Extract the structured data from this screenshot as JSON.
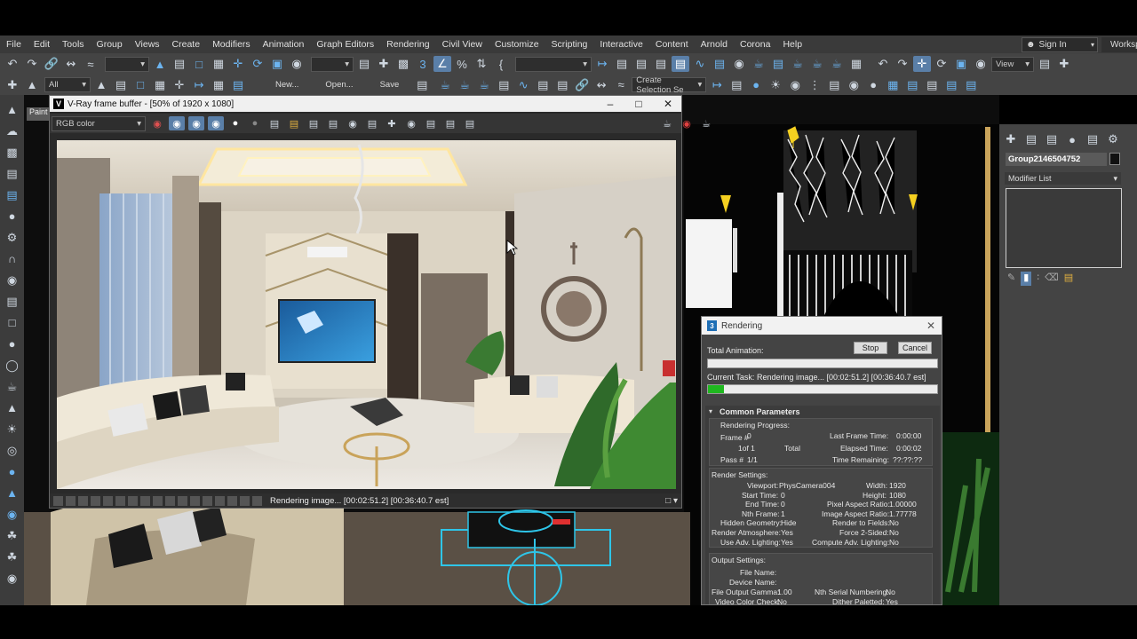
{
  "menu": [
    "File",
    "Edit",
    "Tools",
    "Group",
    "Views",
    "Create",
    "Modifiers",
    "Animation",
    "Graph Editors",
    "Rendering",
    "Civil View",
    "Customize",
    "Scripting",
    "Interactive",
    "Content",
    "Arnold",
    "Corona",
    "Help"
  ],
  "signin_label": "Sign In",
  "workspace_label": "Workspa",
  "toolbar": {
    "filter_value": "All",
    "new_label": "New...",
    "open_label": "Open...",
    "save_label": "Save",
    "view_label": "View",
    "selection_set_placeholder": "Create Selection Se"
  },
  "viewport_tab": "Paint",
  "vfb": {
    "title": "V-Ray frame buffer - [50% of 1920 x 1080]",
    "channel": "RGB color",
    "status": "Rendering image... [00:02:51.2] [00:36:40.7 est]"
  },
  "command_panel": {
    "object_name": "Group2146504752",
    "modifier_list": "Modifier List"
  },
  "rendering_dialog": {
    "title": "Rendering",
    "stop_label": "Stop",
    "cancel_label": "Cancel",
    "total_animation_label": "Total Animation:",
    "total_progress": 0,
    "current_task_label": "Current Task:",
    "current_task_value": "Rendering image... [00:02:51.2] [00:36:40.7 est]",
    "task_progress": 0.07,
    "common_parameters": "Common Parameters",
    "rendering_progress": "Rendering Progress:",
    "frame_label": "Frame #",
    "frame_value": "0",
    "of_label": "1of 1",
    "total_label": "Total",
    "pass_label": "Pass #",
    "pass_value": "1/1",
    "last_frame_time_label": "Last Frame Time:",
    "last_frame_time_value": "0:00:00",
    "elapsed_time_label": "Elapsed Time:",
    "elapsed_time_value": "0:00:02",
    "time_remaining_label": "Time Remaining:",
    "time_remaining_value": "??:??:??",
    "render_settings": "Render Settings:",
    "viewport_label": "Viewport:",
    "viewport_value": "PhysCamera004",
    "width_label": "Width:",
    "width_value": "1920",
    "start_time_label": "Start Time:",
    "start_time_value": "0",
    "height_label": "Height:",
    "height_value": "1080",
    "end_time_label": "End Time:",
    "end_time_value": "0",
    "pixel_aspect_label": "Pixel Aspect Ratio:",
    "pixel_aspect_value": "1.00000",
    "nth_frame_label": "Nth Frame:",
    "nth_frame_value": "1",
    "image_aspect_label": "Image Aspect Ratio:",
    "image_aspect_value": "1.77778",
    "hidden_geometry_label": "Hidden Geometry:",
    "hidden_geometry_value": "Hide",
    "render_to_fields_label": "Render to Fields:",
    "render_to_fields_value": "No",
    "render_atmos_label": "Render Atmosphere:",
    "render_atmos_value": "Yes",
    "force_2sided_label": "Force 2-Sided:",
    "force_2sided_value": "No",
    "adv_lighting_label": "Use Adv. Lighting:",
    "adv_lighting_value": "Yes",
    "compute_adv_label": "Compute Adv. Lighting:",
    "compute_adv_value": "No",
    "output_settings": "Output Settings:",
    "file_name_label": "File Name:",
    "device_name_label": "Device Name:",
    "output_gamma_label": "File Output Gamma:",
    "output_gamma_value": "1.00",
    "nth_serial_label": "Nth Serial Numbering:",
    "nth_serial_value": "No",
    "video_color_label": "Video Color Check:",
    "video_color_value": "No",
    "dither_label": "Dither Paletted:",
    "dither_value": "Yes"
  },
  "colors": {
    "accent": "#6cb4f0",
    "progress": "#1fb81f",
    "panel": "#444444"
  }
}
